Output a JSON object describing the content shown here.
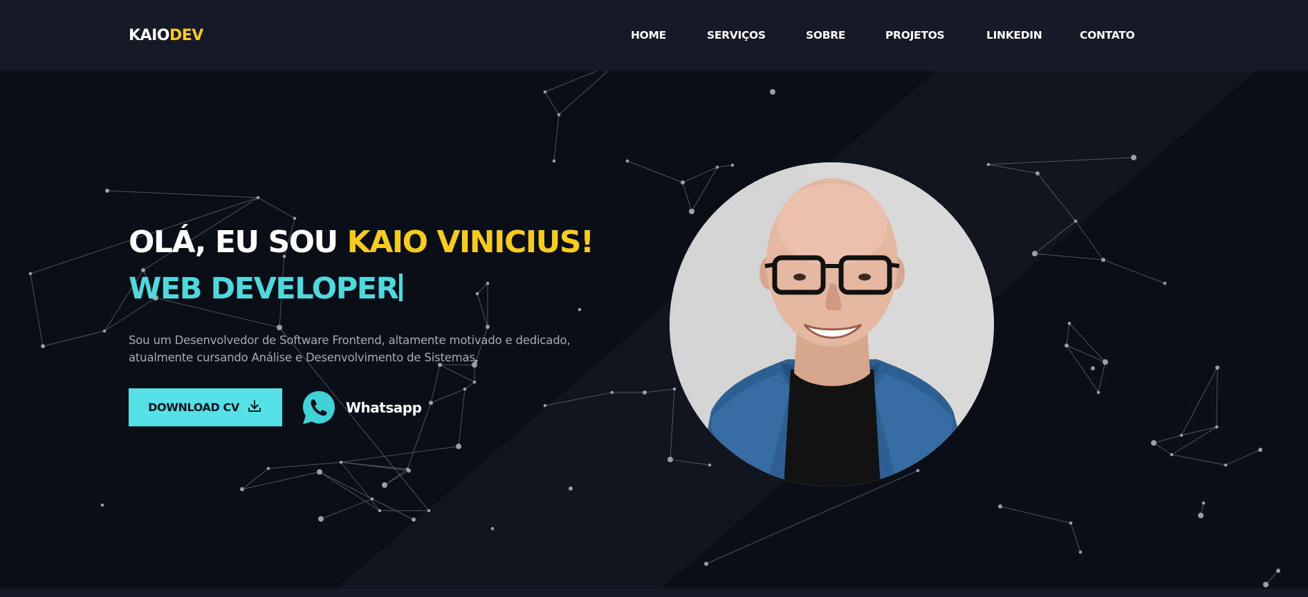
{
  "header": {
    "logo": {
      "part1": "KAIO",
      "part2": "DEV"
    },
    "nav": [
      {
        "label": "HOME",
        "name": "nav-home"
      },
      {
        "label": "SERVIÇOS",
        "name": "nav-servicos"
      },
      {
        "label": "SOBRE",
        "name": "nav-sobre"
      },
      {
        "label": "PROJETOS",
        "name": "nav-projetos"
      },
      {
        "label": "LINKEDIN",
        "name": "nav-linkedin"
      },
      {
        "label": "CONTATO",
        "name": "nav-contato"
      }
    ]
  },
  "hero": {
    "greeting": "OLÁ, EU SOU ",
    "name": "KAIO VINICIUS!",
    "role": "WEB DEVELOPER",
    "description_line1": "Sou um Desenvolvedor de Software Frontend, altamente motivado e dedicado,",
    "description_line2": "atualmente cursando Análise e Desenvolvimento de Sistemas.",
    "download_button": "DOWNLOAD CV",
    "whatsapp_label": "Whatsapp",
    "photo_alt": "profile-photo"
  },
  "colors": {
    "background": "#0a0e16",
    "header": "#151a26",
    "accent_yellow": "#f8cc1c",
    "accent_cyan": "#4fd8de",
    "button_cyan": "#55e1e6",
    "whatsapp_teal": "#3fd3d9"
  },
  "icons": {
    "download": "download-icon",
    "whatsapp": "whatsapp-icon"
  }
}
